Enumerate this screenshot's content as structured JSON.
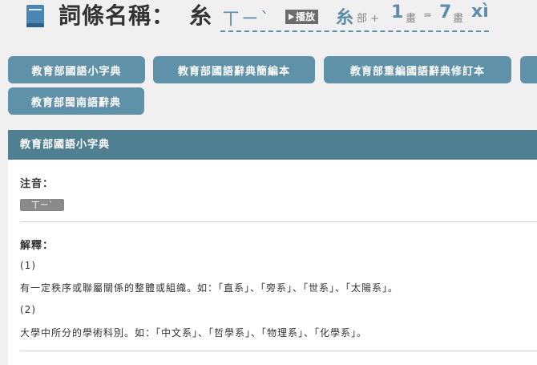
{
  "header": {
    "title_label": "詞條名稱：",
    "character": "糸",
    "zhuyin": "ㄒㄧˋ",
    "play_label": "播放",
    "radical": "糸",
    "radical_suffix": "部",
    "plus": "+",
    "extra_strokes": "1",
    "stroke_unit": "畫",
    "equals": "=",
    "total_strokes": "7",
    "total_stroke_unit": "畫",
    "pinyin": "xì"
  },
  "dictionaries": [
    {
      "label": "教育部國語小字典"
    },
    {
      "label": "教育部國語辭典簡編本"
    },
    {
      "label": "教育部重編國語辭典修訂本"
    },
    {
      "label": "教育部閩南語辭典"
    }
  ],
  "panel": {
    "title": "教育部國語小字典",
    "zhuyin_label": "注音：",
    "zhuyin_value": "ㄒㄧˋ",
    "definition_label": "解釋：",
    "definitions": [
      {
        "num": "(1)",
        "text": "有一定秩序或聯屬關係的整體或組織。如：「直系」、「旁系」、「世系」、「太陽系」。"
      },
      {
        "num": "(2)",
        "text": "大學中所分的學術科別。如：「中文系」、「哲學系」、「物理系」、「化學系」。"
      }
    ]
  },
  "colors": {
    "accent": "#5f92a9",
    "panel_header": "#4f7f91",
    "background": "#f0f0f0"
  }
}
